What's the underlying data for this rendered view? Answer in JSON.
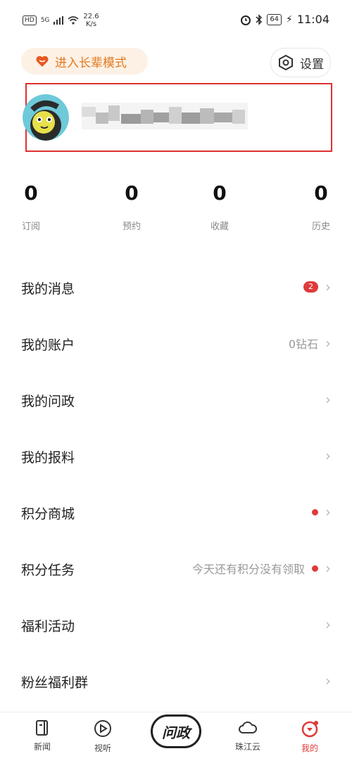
{
  "status_bar": {
    "hd": "HD",
    "network": "5G",
    "speed_value": "22.6",
    "speed_unit": "K/s",
    "battery": "64",
    "time": "11:04"
  },
  "header": {
    "elder_mode_label": "进入长辈模式",
    "settings_label": "设置"
  },
  "stats": [
    {
      "value": "0",
      "label": "订阅"
    },
    {
      "value": "0",
      "label": "预约"
    },
    {
      "value": "0",
      "label": "收藏"
    },
    {
      "value": "0",
      "label": "历史"
    }
  ],
  "menu": [
    {
      "title": "我的消息",
      "badge": "2"
    },
    {
      "title": "我的账户",
      "value": "0钻石"
    },
    {
      "title": "我的问政"
    },
    {
      "title": "我的报料"
    },
    {
      "title": "积分商城",
      "dot": true
    },
    {
      "title": "积分任务",
      "value": "今天还有积分没有领取",
      "dot": true
    },
    {
      "title": "福利活动"
    },
    {
      "title": "粉丝福利群"
    }
  ],
  "tabbar": {
    "tabs": [
      {
        "label": "新闻"
      },
      {
        "label": "视听"
      },
      {
        "label": "珠江云"
      },
      {
        "label": "我的"
      }
    ],
    "center_label": "问政"
  },
  "colors": {
    "accent_red": "#e03a3a",
    "elder_orange": "#e07a1f",
    "elder_bg": "#fdf1e6"
  }
}
